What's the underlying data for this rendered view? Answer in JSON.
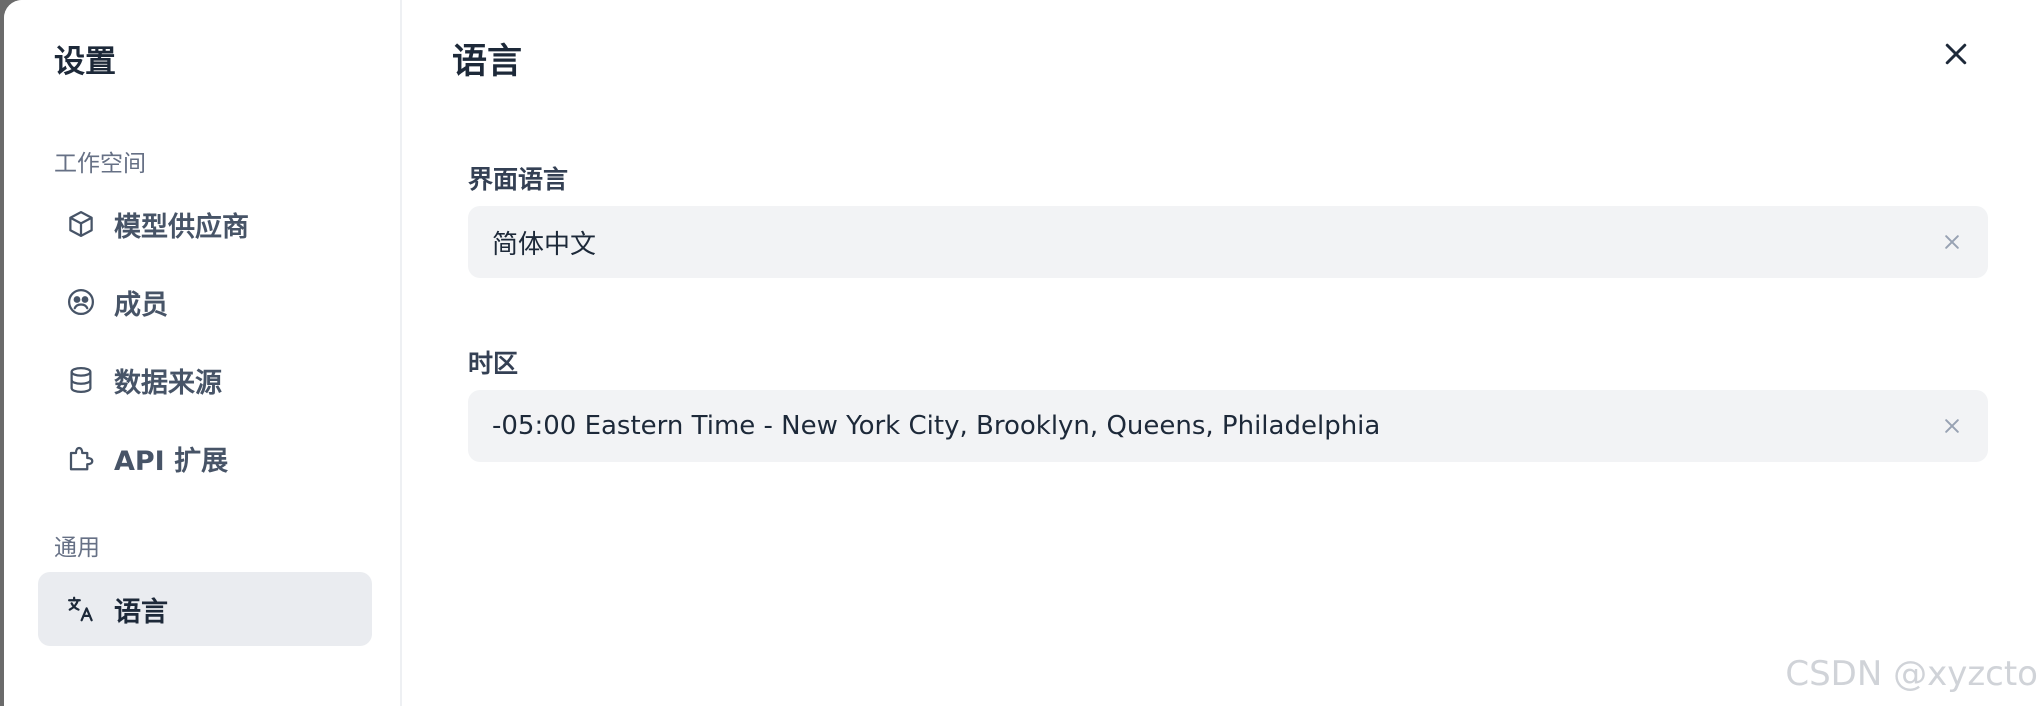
{
  "sidebar": {
    "title": "设置",
    "sections": [
      {
        "label": "工作空间",
        "items": [
          {
            "label": "模型供应商",
            "icon": "cube-icon"
          },
          {
            "label": "成员",
            "icon": "members-icon"
          },
          {
            "label": "数据来源",
            "icon": "database-icon"
          },
          {
            "label": "API 扩展",
            "icon": "puzzle-icon"
          }
        ]
      },
      {
        "label": "通用",
        "items": [
          {
            "label": "语言",
            "icon": "translate-icon",
            "active": true
          }
        ]
      }
    ]
  },
  "main": {
    "title": "语言",
    "fields": [
      {
        "label": "界面语言",
        "value": "简体中文"
      },
      {
        "label": "时区",
        "value": "-05:00 Eastern Time - New York City, Brooklyn, Queens, Philadelphia"
      }
    ]
  },
  "watermark": "CSDN @xyzcto",
  "colors": {
    "active_bg": "#eaecf0",
    "field_bg": "#f2f3f5",
    "text_primary": "#1d2939",
    "text_secondary": "#667085"
  }
}
